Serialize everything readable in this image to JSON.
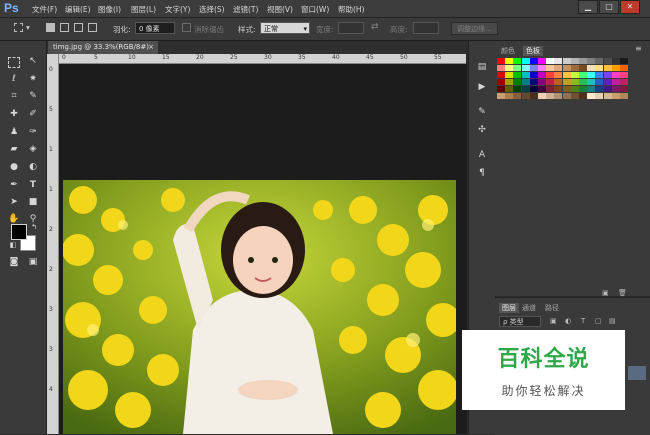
{
  "app": {
    "logo": "Ps"
  },
  "menu": [
    "文件(F)",
    "编辑(E)",
    "图像(I)",
    "图层(L)",
    "文字(Y)",
    "选择(S)",
    "滤镜(T)",
    "视图(V)",
    "窗口(W)",
    "帮助(H)"
  ],
  "window_controls": {
    "minimize": "▁",
    "restore": "□",
    "close": "✕"
  },
  "options": {
    "feather_label": "羽化:",
    "feather_value": "0 像素",
    "antialias_label": "消除锯齿",
    "style_label": "样式:",
    "style_value": "正常",
    "width_label": "宽度:",
    "height_label": "高度:",
    "refine_button": "调整边缘..."
  },
  "document": {
    "tab_label": "timg.jpg @ 33.3%(RGB/8#)",
    "close": "×"
  },
  "rulers": {
    "top": [
      "0",
      "5",
      "10",
      "15",
      "20",
      "25",
      "30",
      "35",
      "40",
      "45",
      "50",
      "55"
    ],
    "left": [
      "0",
      "5",
      "1",
      "1",
      "2",
      "2",
      "3",
      "3",
      "4"
    ]
  },
  "panels": {
    "swatch_tabs": [
      "颜色",
      "色板"
    ],
    "layers_tabs": [
      "图层",
      "通道",
      "路径"
    ],
    "layers_filter": "ρ 类型"
  },
  "swatch_colors": [
    [
      "#ff0000",
      "#ffff00",
      "#00ff00",
      "#00ffff",
      "#0000ff",
      "#ff00ff",
      "#ffffff",
      "#e6e6e6",
      "#cccccc",
      "#b3b3b3",
      "#999999",
      "#808080",
      "#666666",
      "#4d4d4d",
      "#333333",
      "#1a1a1a"
    ],
    [
      "#ff8080",
      "#ffff80",
      "#80ff80",
      "#80ffff",
      "#8080ff",
      "#ff80ff",
      "#f2c6a0",
      "#e0a878",
      "#c8905a",
      "#a06a3c",
      "#7a4a24",
      "#f0e0c0",
      "#ffe080",
      "#ffc040",
      "#ffa000",
      "#ff6000"
    ],
    [
      "#e00000",
      "#e0e000",
      "#00c000",
      "#00c0c0",
      "#0000c0",
      "#c000c0",
      "#ff4040",
      "#ff8040",
      "#ffc040",
      "#c0ff40",
      "#40ff80",
      "#40ffff",
      "#4080ff",
      "#8040ff",
      "#ff40c0",
      "#ff4080"
    ],
    [
      "#a00000",
      "#a0a000",
      "#008000",
      "#008080",
      "#000080",
      "#800080",
      "#c02040",
      "#c06020",
      "#c0a020",
      "#80c020",
      "#20c060",
      "#20c0c0",
      "#2060c0",
      "#6020c0",
      "#c020a0",
      "#c02060"
    ],
    [
      "#600000",
      "#606000",
      "#004000",
      "#004040",
      "#000040",
      "#400040",
      "#802030",
      "#804018",
      "#806018",
      "#508018",
      "#188040",
      "#188080",
      "#184080",
      "#401880",
      "#801868",
      "#801840"
    ],
    [
      "#c8a070",
      "#a88050",
      "#886040",
      "#684830",
      "#483020",
      "#f0d0b0",
      "#d0b090",
      "#b09070",
      "#907050",
      "#705030",
      "#503018",
      "#f8e8d0",
      "#e8d0b0",
      "#d8b890",
      "#c8a070",
      "#b08858"
    ]
  ],
  "watermark": {
    "title": "百科全说",
    "subtitle": "助你轻松解决"
  }
}
